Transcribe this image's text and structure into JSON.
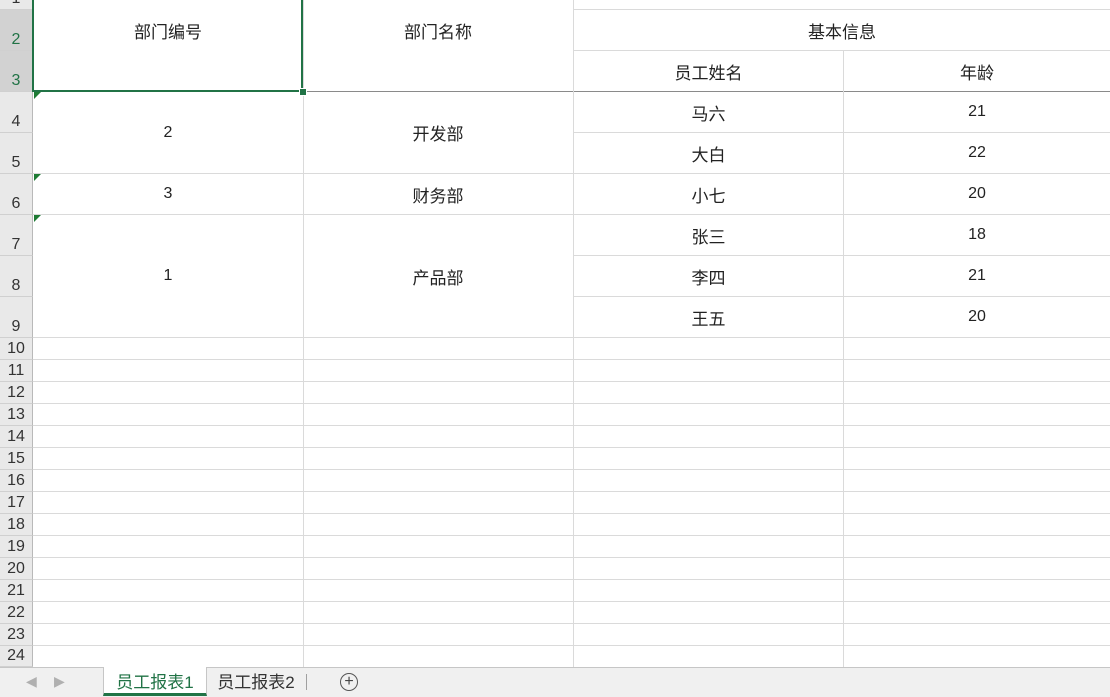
{
  "sheet": {
    "row_numbers": [
      "1",
      "2",
      "3",
      "4",
      "5",
      "6",
      "7",
      "8",
      "9",
      "10",
      "11",
      "12",
      "13",
      "14",
      "15",
      "16",
      "17",
      "18",
      "19",
      "20",
      "21",
      "22",
      "23",
      "24"
    ],
    "header": {
      "dept_id": "部门编号",
      "dept_name": "部门名称",
      "basic_info": "基本信息",
      "employee_name": "员工姓名",
      "age": "年龄"
    },
    "departments": [
      {
        "id": "2",
        "name": "开发部"
      },
      {
        "id": "3",
        "name": "财务部"
      },
      {
        "id": "1",
        "name": "产品部"
      }
    ],
    "employees": [
      {
        "name": "马六",
        "age": "21"
      },
      {
        "name": "大白",
        "age": "22"
      },
      {
        "name": "小七",
        "age": "20"
      },
      {
        "name": "张三",
        "age": "18"
      },
      {
        "name": "李四",
        "age": "21"
      },
      {
        "name": "王五",
        "age": "20"
      }
    ]
  },
  "tabs": {
    "sheets": [
      "员工报表1",
      "员工报表2"
    ],
    "active_index": 0,
    "add_icon": "+"
  },
  "colors": {
    "accent": "#217346",
    "indicator": "#1e7b34",
    "gridline": "#dadada"
  }
}
